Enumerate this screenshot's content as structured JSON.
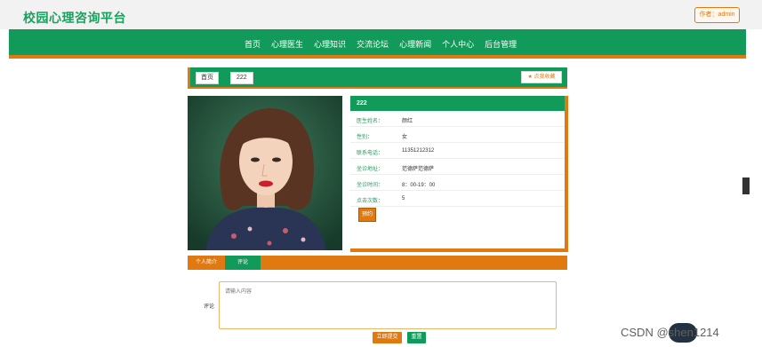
{
  "header": {
    "site_title": "校园心理咨询平台",
    "author_label": "作者：admin"
  },
  "nav": {
    "items": [
      "首页",
      "心理医生",
      "心理知识",
      "交流论坛",
      "心理新闻",
      "个人中心",
      "后台管理"
    ]
  },
  "breadcrumb": {
    "home": "首页",
    "current": "222",
    "favorite_label": "点我收藏"
  },
  "doctor": {
    "name_header": "222",
    "fields": [
      {
        "label": "医生姓名：",
        "value": "颜红"
      },
      {
        "label": "性别：",
        "value": "女"
      },
      {
        "label": "联系电话：",
        "value": "11351212312"
      },
      {
        "label": "坐诊地址：",
        "value": "范德萨范德萨"
      },
      {
        "label": "坐诊时间：",
        "value": "8：00-19：00"
      },
      {
        "label": "点击次数：",
        "value": "5"
      }
    ],
    "book_label": "预约"
  },
  "tabs": {
    "intro": "个人简介",
    "comments": "评论"
  },
  "comment": {
    "label": "评论",
    "placeholder": "请输入内容",
    "submit_label": "立即提交",
    "reset_label": "重置"
  },
  "watermark": {
    "text": "CSDN @shen1214"
  },
  "colors": {
    "primary_green": "#129a5a",
    "accent_orange": "#e07a10"
  }
}
